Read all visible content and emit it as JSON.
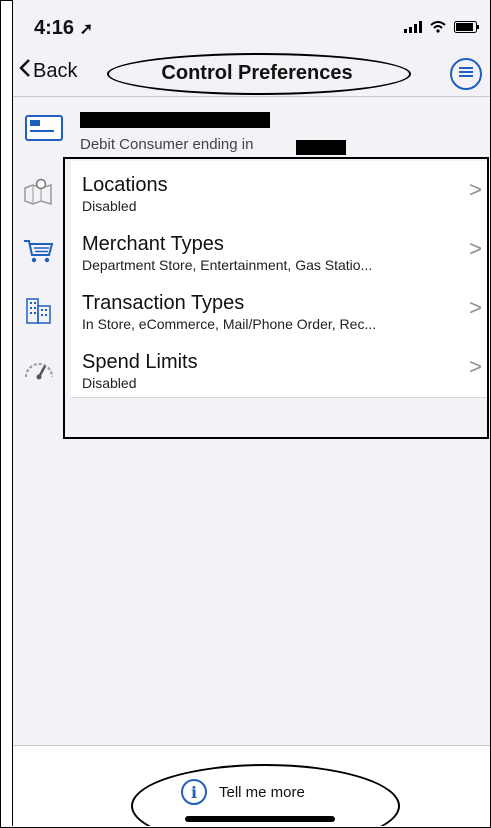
{
  "status_bar": {
    "time": "4:16"
  },
  "nav": {
    "back_label": "Back",
    "title": "Control Preferences"
  },
  "account": {
    "description": "Debit Consumer ending in"
  },
  "controls": [
    {
      "label": "Locations",
      "sub": "Disabled",
      "icon": "map-pin-icon"
    },
    {
      "label": "Merchant Types",
      "sub": "Department Store, Entertainment, Gas Statio...",
      "icon": "shopping-cart-icon"
    },
    {
      "label": "Transaction Types",
      "sub": "In Store, eCommerce, Mail/Phone Order, Rec...",
      "icon": "building-icon"
    },
    {
      "label": "Spend Limits",
      "sub": "Disabled",
      "icon": "speedometer-icon"
    }
  ],
  "footer": {
    "info_label": "Tell me more"
  },
  "colors": {
    "accent": "#1f5fbf",
    "background": "#f2f2f7"
  }
}
